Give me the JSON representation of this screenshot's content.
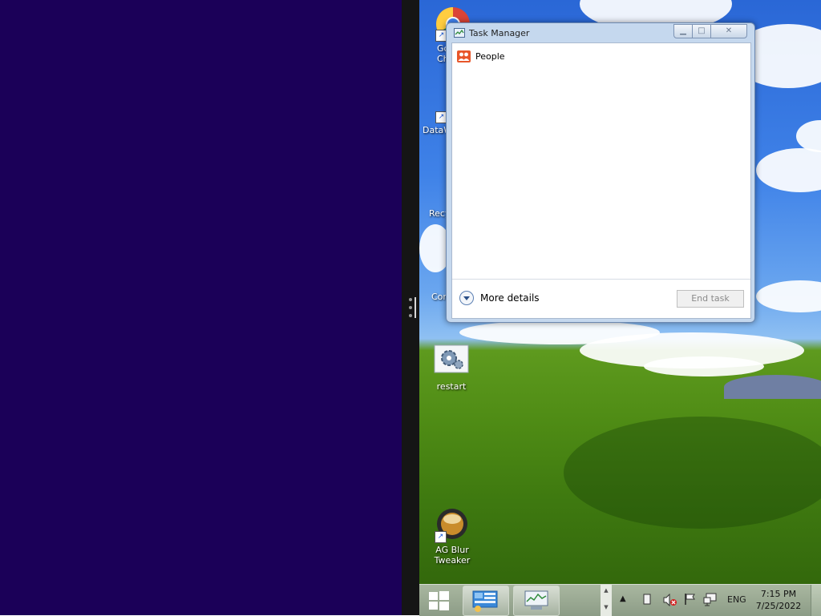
{
  "desktop": {
    "icons": [
      {
        "label": "Go\nChr",
        "icon": "chrome-icon"
      },
      {
        "label": "DataW",
        "icon": "datawrapper-icon"
      },
      {
        "label": "Recy",
        "icon": "recycle-bin-icon"
      },
      {
        "label": "Cor",
        "icon": "control-panel-icon"
      },
      {
        "label": "restart",
        "icon": "restart-gear-icon"
      },
      {
        "label": "AG Blur\nTweaker",
        "icon": "ag-blur-tweaker-icon"
      }
    ]
  },
  "task_manager": {
    "title": "Task Manager",
    "apps": [
      {
        "name": "People",
        "icon": "people-icon"
      }
    ],
    "more_details_label": "More details",
    "end_task_label": "End task"
  },
  "taskbar": {
    "language": "ENG",
    "time": "7:15 PM",
    "date": "7/25/2022",
    "tray_icons": [
      "show-hidden-icons-icon",
      "tablet-icon",
      "volume-muted-icon",
      "action-center-flag-icon",
      "network-icon"
    ]
  },
  "colors": {
    "left_pane": "#1b0058",
    "tm_frame": "#c5d8ee",
    "people_accent": "#e8562a"
  }
}
